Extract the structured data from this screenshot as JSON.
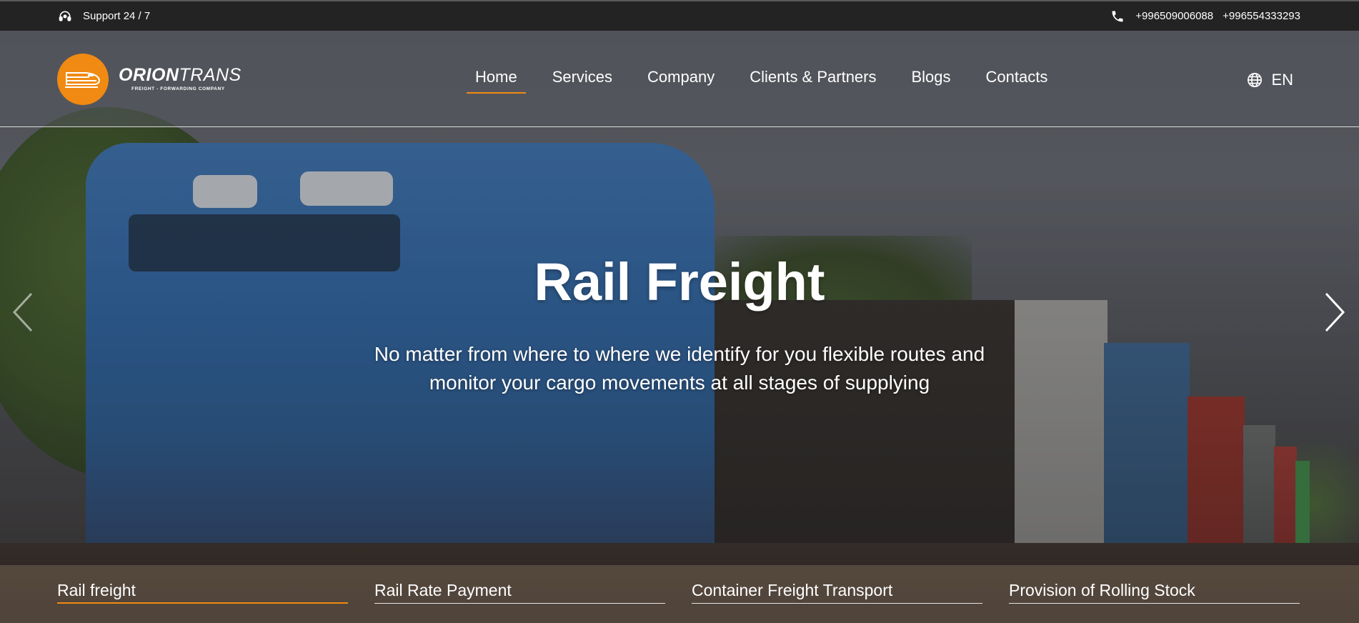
{
  "topbar": {
    "support_icon": "headset-icon",
    "support_text": "Support 24 / 7",
    "phone_icon": "phone-icon",
    "phone1": "+996509006088",
    "phone2": "+996554333293"
  },
  "header": {
    "logo": {
      "brand_bold": "ORION",
      "brand_light": "TRANS",
      "tagline": "FREIGHT - FORWARDING COMPANY",
      "brand_color": "#f08a12"
    },
    "nav": [
      {
        "label": "Home",
        "active": true
      },
      {
        "label": "Services"
      },
      {
        "label": "Company"
      },
      {
        "label": "Clients & Partners"
      },
      {
        "label": "Blogs"
      },
      {
        "label": "Contacts"
      }
    ],
    "language": {
      "icon": "globe-icon",
      "label": "EN"
    }
  },
  "hero": {
    "title": "Rail Freight",
    "subtitle_line1": "No matter from where to where we identify for you flexible routes and",
    "subtitle_line2": "monitor your cargo movements at all stages of supplying",
    "prev_icon": "chevron-left-icon",
    "next_icon": "chevron-right-icon"
  },
  "tabs": [
    {
      "label": "Rail freight",
      "active": true
    },
    {
      "label": "Rail Rate Payment"
    },
    {
      "label": "Container Freight Transport"
    },
    {
      "label": "Provision of Rolling Stock"
    }
  ],
  "colors": {
    "accent": "#f08a12",
    "topbar": "#232323"
  }
}
